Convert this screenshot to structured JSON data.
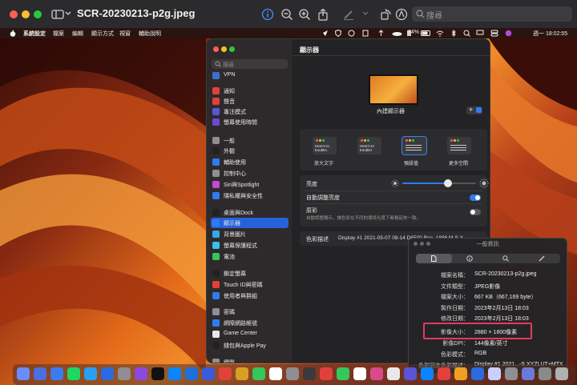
{
  "window": {
    "title": "SCR-20230213-p2g.jpeg",
    "search_placeholder": "搜尋"
  },
  "menubar": {
    "left": [
      "系統設定",
      "檔案",
      "編輯",
      "顯示方式",
      "視窗",
      "輔助說明"
    ],
    "battery": "74%",
    "clock": "週一 18:02:55"
  },
  "settings": {
    "search_placeholder": "搜尋",
    "sidebar": [
      {
        "label": "VPN",
        "color": "#3b6fd8"
      },
      {
        "label": "通知",
        "color": "#e2413b"
      },
      {
        "label": "聲音",
        "color": "#e2413b"
      },
      {
        "label": "專注模式",
        "color": "#5a55d8"
      },
      {
        "label": "螢幕使用時間",
        "color": "#6a4ad8"
      },
      {
        "label": "一般",
        "color": "#8e8e93"
      },
      {
        "label": "外觀",
        "color": "#222222"
      },
      {
        "label": "輔助使用",
        "color": "#2f7cf0"
      },
      {
        "label": "控制中心",
        "color": "#8e8e93"
      },
      {
        "label": "Siri與Spotlight",
        "color": "#c04ad8"
      },
      {
        "label": "隱私權與安全性",
        "color": "#2f7cf0"
      },
      {
        "label": "桌面與Dock",
        "color": "#222222"
      },
      {
        "label": "顯示器",
        "color": "#2f7cf0",
        "selected": true
      },
      {
        "label": "背景圖片",
        "color": "#37a7e8"
      },
      {
        "label": "螢幕保護程式",
        "color": "#37c0e8"
      },
      {
        "label": "電池",
        "color": "#34c759"
      },
      {
        "label": "鎖定螢幕",
        "color": "#222222"
      },
      {
        "label": "Touch ID與密碼",
        "color": "#e2413b"
      },
      {
        "label": "使用者與群組",
        "color": "#2f7cf0"
      },
      {
        "label": "密碼",
        "color": "#8e8e93"
      },
      {
        "label": "網際網路帳號",
        "color": "#2f7cf0"
      },
      {
        "label": "Game Center",
        "color": "#e8e8e8"
      },
      {
        "label": "錢包與Apple Pay",
        "color": "#222222"
      },
      {
        "label": "鍵盤",
        "color": "#8e8e93"
      }
    ],
    "content": {
      "title": "顯示器",
      "display_name": "內建顯示器",
      "options": [
        {
          "label": "放大文字",
          "sample": "Here's to\ntroubleı"
        },
        {
          "label": "",
          "sample": "Here's to\ntroubler"
        },
        {
          "label": "預設值",
          "sample": "",
          "selected": true
        },
        {
          "label": "更多空間",
          "sample": ""
        }
      ],
      "brightness_label": "亮度",
      "brightness_level": 0.62,
      "auto_brightness_label": "自動調整亮度",
      "auto_brightness_on": true,
      "truetone_label": "原彩",
      "truetone_desc": "自動調整顯示，讓色彩在不同的環境光度下都看起來一致。",
      "truetone_on": false,
      "color_profile_label": "色彩描述",
      "color_profile_value": "Display #1 2021-05-07 08-14 D6500 Rec. 1886 M-S X..."
    }
  },
  "info_panel": {
    "title": "一般資訊",
    "rows": [
      {
        "k": "檔案名稱：",
        "v": "SCR-20230213-p2g.jpeg"
      },
      {
        "k": "文件類型：",
        "v": "JPEG影像"
      },
      {
        "k": "檔案大小：",
        "v": "667 KB（667,169 byte）"
      },
      {
        "k": "製作日期：",
        "v": "2023年2月13日 18:03"
      },
      {
        "k": "修改日期：",
        "v": "2023年2月13日 18:03"
      },
      {
        "k": "影像大小：",
        "v": "2880 × 1800像素"
      },
      {
        "k": "影像DPI：",
        "v": "144像素/英寸"
      },
      {
        "k": "色彩模式：",
        "v": "RGB"
      },
      {
        "k": "色彩同步色彩描述：",
        "v": "Display #1 2021...-S XYZLUT+MTX"
      }
    ]
  },
  "dock": {
    "colors": [
      "#6a8cff",
      "#4a6fe0",
      "#3a7cf0",
      "#1ed760",
      "#2a9df4",
      "#2a6be0",
      "#8e8e93",
      "#8a4ae0",
      "#111111",
      "#0a84ff",
      "#1e6fd9",
      "#3a5ae0",
      "#e2413b",
      "#d8a020",
      "#34c759",
      "#ffffff",
      "#8e8e93",
      "#3a3a3c",
      "#e2413b",
      "#34c759",
      "#ffffff",
      "#d84a8a",
      "#e8e8e8",
      "#5a55d8",
      "#0a84ff",
      "#e2413b",
      "#f0a020",
      "#2a6be0",
      "#c8d0ff",
      "#8e8e93",
      "#6a7ad8",
      "#8a8a8a",
      "#b0b0b0"
    ]
  }
}
